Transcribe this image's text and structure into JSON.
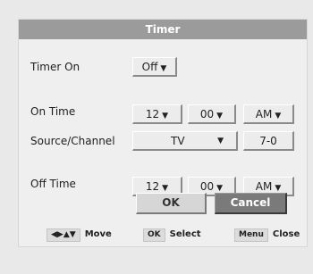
{
  "dialog": {
    "title": "Timer"
  },
  "timer_on": {
    "label": "Timer On",
    "value": "Off"
  },
  "on_time": {
    "label": "On Time",
    "hour": "12",
    "minute": "00",
    "ampm": "AM"
  },
  "source_channel": {
    "label": "Source/Channel",
    "source": "TV",
    "channel": "7-0"
  },
  "off_time": {
    "label": "Off Time",
    "hour": "12",
    "minute": "00",
    "ampm": "AM"
  },
  "buttons": {
    "ok": "OK",
    "cancel": "Cancel"
  },
  "help": {
    "move_key": "◀▶▲▼",
    "move_label": "Move",
    "select_key": "OK",
    "select_label": "Select",
    "close_key": "Menu",
    "close_label": "Close"
  },
  "icons": {
    "dropdown_arrow": "chevron-down-icon"
  },
  "colors": {
    "title_bar": "#9b9b9b",
    "cancel_button": "#7a7a7a",
    "ok_button": "#d6d6d6",
    "panel": "#efefef"
  }
}
